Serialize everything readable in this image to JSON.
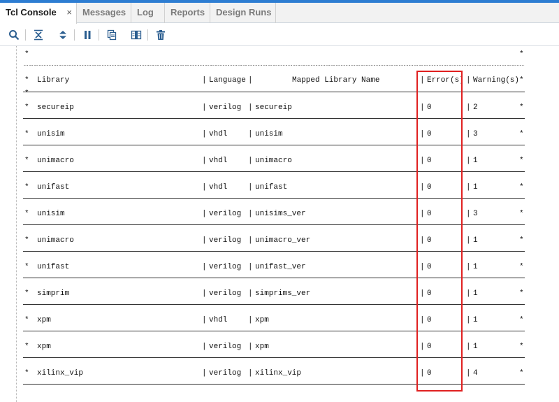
{
  "tabs": [
    {
      "label": "Tcl Console",
      "active": true,
      "closable": true,
      "close_glyph": "×"
    },
    {
      "label": "Messages",
      "active": false
    },
    {
      "label": "Log",
      "active": false
    },
    {
      "label": "Reports",
      "active": false
    },
    {
      "label": "Design Runs",
      "active": false
    }
  ],
  "toolbar": {
    "buttons": [
      "search-icon",
      "collapse-all-icon",
      "expand-all-icon",
      "pause-icon",
      "copy-icon",
      "columns-icon",
      "trash-icon"
    ]
  },
  "console": {
    "star_char": "*",
    "star_rule": "**********************************************************************************************************************************************************************************************************",
    "header": {
      "library": "Library",
      "language": "Language",
      "mapped": "Mapped Library Name",
      "errors": "Error(s)",
      "warnings": "Warning(s)"
    },
    "rows": [
      {
        "library": "secureip",
        "language": "verilog",
        "mapped": "secureip",
        "errors": "0",
        "warnings": "2"
      },
      {
        "library": "unisim",
        "language": "vhdl",
        "mapped": "unisim",
        "errors": "0",
        "warnings": "3"
      },
      {
        "library": "unimacro",
        "language": "vhdl",
        "mapped": "unimacro",
        "errors": "0",
        "warnings": "1"
      },
      {
        "library": "unifast",
        "language": "vhdl",
        "mapped": "unifast",
        "errors": "0",
        "warnings": "1"
      },
      {
        "library": "unisim",
        "language": "verilog",
        "mapped": "unisims_ver",
        "errors": "0",
        "warnings": "3"
      },
      {
        "library": "unimacro",
        "language": "verilog",
        "mapped": "unimacro_ver",
        "errors": "0",
        "warnings": "1"
      },
      {
        "library": "unifast",
        "language": "verilog",
        "mapped": "unifast_ver",
        "errors": "0",
        "warnings": "1"
      },
      {
        "library": "simprim",
        "language": "verilog",
        "mapped": "simprims_ver",
        "errors": "0",
        "warnings": "1"
      },
      {
        "library": "xpm",
        "language": "vhdl",
        "mapped": "xpm",
        "errors": "0",
        "warnings": "1"
      },
      {
        "library": "xpm",
        "language": "verilog",
        "mapped": "xpm",
        "errors": "0",
        "warnings": "1"
      },
      {
        "library": "xilinx_vip",
        "language": "verilog",
        "mapped": "xilinx_vip",
        "errors": "0",
        "warnings": "4"
      }
    ],
    "pipe": "|",
    "highlight_color": "#e02020"
  }
}
